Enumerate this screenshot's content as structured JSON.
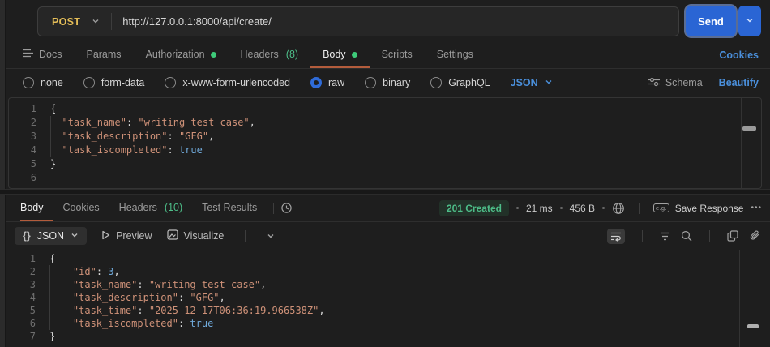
{
  "theme": {
    "background": "#1e1e1e",
    "method_yellow": "#e5be58",
    "send_blue": "#2a65d4",
    "accent_orange": "#b35c3c",
    "link_blue": "#4a8fdb",
    "green": "#3ecb7a",
    "badge_green": "#4dbd88",
    "code_string": "#ce9178",
    "code_literal": "#6fa8d8"
  },
  "request": {
    "method": "POST",
    "url": "http://127.0.0.1:8000/api/create/",
    "send_label": "Send",
    "tabs": [
      {
        "label": "Docs"
      },
      {
        "label": "Params"
      },
      {
        "label": "Authorization",
        "dot": true
      },
      {
        "label": "Headers",
        "count": "(8)"
      },
      {
        "label": "Body",
        "dot": true,
        "active": true
      },
      {
        "label": "Scripts"
      },
      {
        "label": "Settings"
      }
    ],
    "cookies_label": "Cookies",
    "modes": [
      {
        "label": "none"
      },
      {
        "label": "form-data"
      },
      {
        "label": "x-www-form-urlencoded"
      },
      {
        "label": "raw",
        "selected": true
      },
      {
        "label": "binary"
      },
      {
        "label": "GraphQL"
      }
    ],
    "language_label": "JSON",
    "schema_label": "Schema",
    "beautify_label": "Beautify",
    "editor": {
      "lines": [
        {
          "n": "1",
          "guide": false,
          "tokens": [
            {
              "c": "p",
              "t": "{"
            }
          ]
        },
        {
          "n": "2",
          "guide": true,
          "tokens": [
            {
              "c": "p",
              "t": "  "
            },
            {
              "c": "k",
              "t": "\"task_name\""
            },
            {
              "c": "p",
              "t": ": "
            },
            {
              "c": "s",
              "t": "\"writing test case\""
            },
            {
              "c": "p",
              "t": ","
            }
          ]
        },
        {
          "n": "3",
          "guide": true,
          "tokens": [
            {
              "c": "p",
              "t": "  "
            },
            {
              "c": "k",
              "t": "\"task_description\""
            },
            {
              "c": "p",
              "t": ": "
            },
            {
              "c": "s",
              "t": "\"GFG\""
            },
            {
              "c": "p",
              "t": ","
            }
          ]
        },
        {
          "n": "4",
          "guide": true,
          "tokens": [
            {
              "c": "p",
              "t": "  "
            },
            {
              "c": "k",
              "t": "\"task_iscompleted\""
            },
            {
              "c": "p",
              "t": ": "
            },
            {
              "c": "b",
              "t": "true"
            }
          ]
        },
        {
          "n": "5",
          "guide": false,
          "tokens": [
            {
              "c": "p",
              "t": "}"
            }
          ]
        },
        {
          "n": "6",
          "guide": false,
          "tokens": []
        }
      ]
    }
  },
  "response": {
    "tabs": [
      {
        "label": "Body",
        "active": true
      },
      {
        "label": "Cookies"
      },
      {
        "label": "Headers",
        "count": "(10)"
      },
      {
        "label": "Test Results"
      }
    ],
    "status": "201 Created",
    "time": "21 ms",
    "size": "456 B",
    "example_icon_label": "e.g.",
    "save_label": "Save Response",
    "more_label": "•••",
    "viewer": {
      "braces": "{}",
      "format_label": "JSON",
      "preview_label": "Preview",
      "visualize_label": "Visualize"
    },
    "editor": {
      "lines": [
        {
          "n": "1",
          "guide": false,
          "tokens": [
            {
              "c": "p",
              "t": "{"
            }
          ]
        },
        {
          "n": "2",
          "guide": true,
          "tokens": [
            {
              "c": "p",
              "t": "    "
            },
            {
              "c": "k",
              "t": "\"id\""
            },
            {
              "c": "p",
              "t": ": "
            },
            {
              "c": "b",
              "t": "3"
            },
            {
              "c": "p",
              "t": ","
            }
          ]
        },
        {
          "n": "3",
          "guide": true,
          "tokens": [
            {
              "c": "p",
              "t": "    "
            },
            {
              "c": "k",
              "t": "\"task_name\""
            },
            {
              "c": "p",
              "t": ": "
            },
            {
              "c": "s",
              "t": "\"writing test case\""
            },
            {
              "c": "p",
              "t": ","
            }
          ]
        },
        {
          "n": "4",
          "guide": true,
          "tokens": [
            {
              "c": "p",
              "t": "    "
            },
            {
              "c": "k",
              "t": "\"task_description\""
            },
            {
              "c": "p",
              "t": ": "
            },
            {
              "c": "s",
              "t": "\"GFG\""
            },
            {
              "c": "p",
              "t": ","
            }
          ]
        },
        {
          "n": "5",
          "guide": true,
          "tokens": [
            {
              "c": "p",
              "t": "    "
            },
            {
              "c": "k",
              "t": "\"task_time\""
            },
            {
              "c": "p",
              "t": ": "
            },
            {
              "c": "s",
              "t": "\"2025-12-17T06:36:19.966538Z\""
            },
            {
              "c": "p",
              "t": ","
            }
          ]
        },
        {
          "n": "6",
          "guide": true,
          "tokens": [
            {
              "c": "p",
              "t": "    "
            },
            {
              "c": "k",
              "t": "\"task_iscompleted\""
            },
            {
              "c": "p",
              "t": ": "
            },
            {
              "c": "b",
              "t": "true"
            }
          ]
        },
        {
          "n": "7",
          "guide": false,
          "tokens": [
            {
              "c": "p",
              "t": "}"
            }
          ]
        }
      ]
    }
  }
}
